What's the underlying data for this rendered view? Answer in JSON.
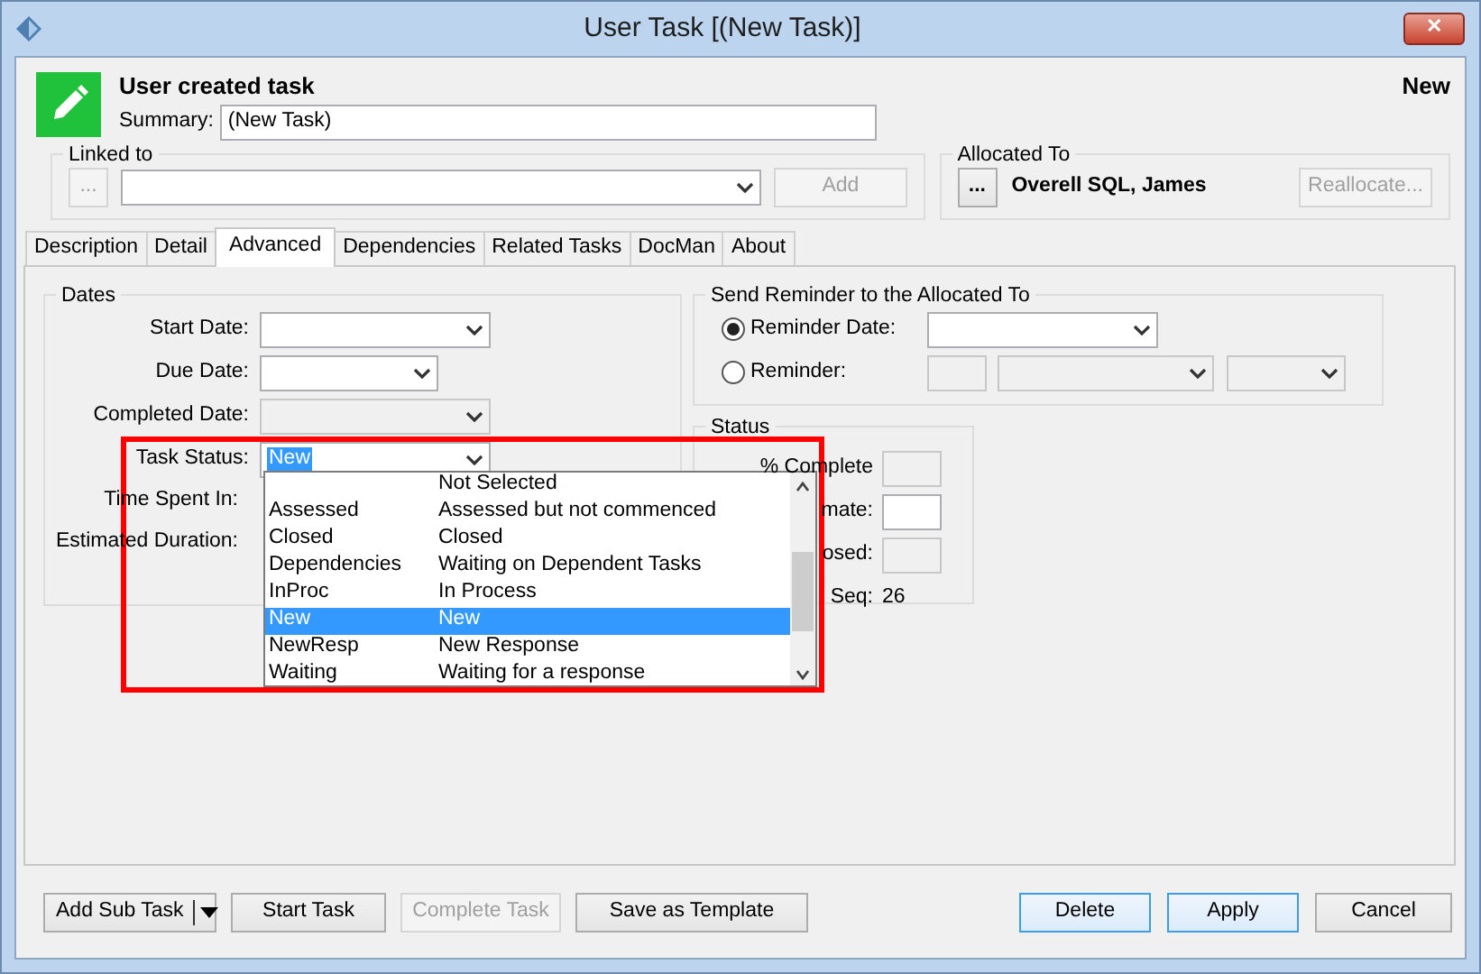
{
  "window": {
    "title": "User Task [(New Task)]",
    "close": "✕"
  },
  "header": {
    "title": "User created task",
    "status": "New",
    "summary_label": "Summary:",
    "summary_value": "(New Task)"
  },
  "linked_to": {
    "label": "Linked to",
    "browse_button": {
      "label": "...",
      "disabled": true
    },
    "add_button": {
      "label": "Add",
      "disabled": true
    }
  },
  "allocated_to": {
    "label": "Allocated To",
    "browse_button": {
      "label": "...",
      "disabled": false
    },
    "name": "Overell SQL, James",
    "reallocate_button": {
      "label": "Reallocate...",
      "disabled": true
    }
  },
  "tabs": [
    {
      "label": "Description",
      "selected": false
    },
    {
      "label": "Detail",
      "selected": false
    },
    {
      "label": "Advanced",
      "selected": true
    },
    {
      "label": "Dependencies",
      "selected": false
    },
    {
      "label": "Related Tasks",
      "selected": false
    },
    {
      "label": "DocMan",
      "selected": false
    },
    {
      "label": "About",
      "selected": false
    }
  ],
  "dates": {
    "title": "Dates",
    "fields": [
      {
        "label": "Start Date:",
        "kind": "wide",
        "disabled": false
      },
      {
        "label": "Due Date:",
        "kind": "narrow",
        "disabled": false
      },
      {
        "label": "Completed Date:",
        "kind": "wide",
        "disabled": true
      },
      {
        "label": "Task Status:",
        "kind": "wide",
        "disabled": false,
        "value": "New",
        "value_selected": true
      },
      {
        "label": "Time Spent In:",
        "kind": "covered"
      },
      {
        "label": "Estimated Duration:",
        "kind": "covered"
      }
    ]
  },
  "reminder": {
    "title": "Send Reminder to the Allocated To",
    "options": [
      {
        "label": "Reminder Date:",
        "kind": "date",
        "selected": true
      },
      {
        "label": "Reminder:",
        "kind": "interval",
        "selected": false
      }
    ]
  },
  "status": {
    "title": "Status",
    "rows": [
      {
        "label": "% Complete",
        "kind": "box",
        "disabled": true
      },
      {
        "label": "mate:",
        "kind": "box",
        "disabled": false
      },
      {
        "label": "osed:",
        "kind": "box",
        "disabled": true
      },
      {
        "label": "Seq:",
        "kind": "text",
        "value": "26"
      }
    ]
  },
  "status_dropdown": {
    "items": [
      {
        "description": "Not Selected",
        "selected": false
      },
      {
        "code": "Assessed",
        "description": "Assessed but not commenced",
        "selected": false
      },
      {
        "code": "Closed",
        "description": "Closed",
        "selected": false
      },
      {
        "code": "Dependencies",
        "description": "Waiting on Dependent Tasks",
        "selected": false
      },
      {
        "code": "InProc",
        "description": "In Process",
        "selected": false
      },
      {
        "code": "New",
        "description": "New",
        "selected": true
      },
      {
        "code": "NewResp",
        "description": "New Response",
        "selected": false
      },
      {
        "code": "Waiting",
        "description": "Waiting for a response",
        "selected": false
      }
    ]
  },
  "footer": {
    "left_buttons": [
      {
        "label": "Add Sub Task",
        "kind": "split",
        "disabled": false
      },
      {
        "label": "Start Task",
        "kind": "plain",
        "disabled": false
      },
      {
        "label": "Complete Task",
        "kind": "plain",
        "disabled": true
      },
      {
        "label": "Save as Template",
        "kind": "plain",
        "disabled": false
      }
    ],
    "right_buttons": [
      {
        "label": "Delete",
        "focused": true
      },
      {
        "label": "Apply",
        "focused": true
      },
      {
        "label": "Cancel",
        "focused": false
      }
    ]
  }
}
